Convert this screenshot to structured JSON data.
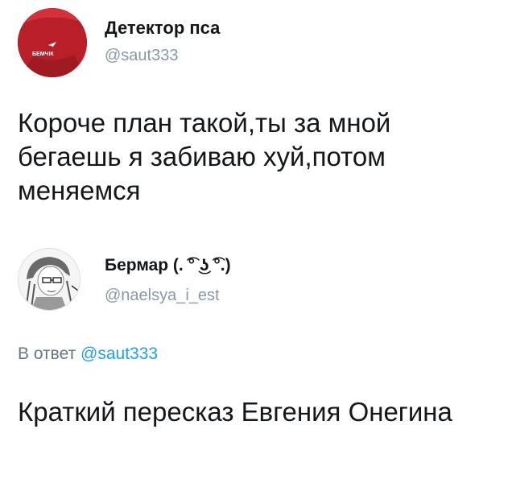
{
  "tweet1": {
    "avatar_icon": "user-avatar-red-shirt",
    "display_name": "Детектор пса",
    "handle": "@saut333",
    "text": "Короче план такой,ты за мной бегаешь я забиваю хуй,потом меняемся"
  },
  "tweet2": {
    "avatar_icon": "user-avatar-anime-sketch",
    "display_name": "Бермар (. ͡° ͜ʖ ͡°.)",
    "handle": "@naelsya_i_est",
    "reply_prefix": "В ответ",
    "reply_mention": "@saut333",
    "text": "Краткий пересказ Евгения Онегина"
  },
  "colors": {
    "text": "#14171a",
    "handle": "#8899a6",
    "mention": "#1da1f2",
    "avatar1": "#c4232b"
  }
}
